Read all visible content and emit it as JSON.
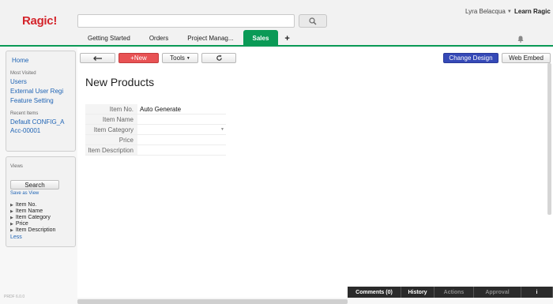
{
  "header": {
    "logo": "Ragic!",
    "search_placeholder": "",
    "user_name": "Lyra Belacqua",
    "learn_label": "Learn Ragic"
  },
  "tabs": [
    {
      "label": "Getting Started",
      "active": false
    },
    {
      "label": "Orders",
      "active": false
    },
    {
      "label": "Project Manag...",
      "active": false
    },
    {
      "label": "Sales",
      "active": true
    }
  ],
  "tab_add_label": "+",
  "sidebar": {
    "home": "Home",
    "most_visited_title": "Most Visited",
    "most_visited": [
      "Users",
      "External User Regi",
      "Feature Setting"
    ],
    "recent_title": "Recent Items",
    "recent": [
      "Default CONFIG_A",
      "Acc-00001"
    ],
    "views_title": "Views",
    "search_label": "Search",
    "save_as_view": "Save as View",
    "fields": [
      "Item No.",
      "Item Name",
      "Item Category",
      "Price",
      "Item Description"
    ],
    "less_label": "Less",
    "version": "PRDF 6.0.0"
  },
  "toolbar": {
    "new_label": "+New",
    "tools_label": "Tools",
    "change_design_label": "Change Design",
    "web_embed_label": "Web Embed"
  },
  "page": {
    "title": "New Products"
  },
  "form": {
    "rows": [
      {
        "label": "Item No.",
        "value": "Auto Generate"
      },
      {
        "label": "Item Name",
        "value": ""
      },
      {
        "label": "Item Category",
        "value": ""
      },
      {
        "label": "Price",
        "value": ""
      },
      {
        "label": "Item Description",
        "value": ""
      }
    ]
  },
  "bottom_bar": {
    "comments": "Comments (0)",
    "history": "History",
    "actions": "Actions",
    "approval": "Approval",
    "info": "i"
  },
  "colors": {
    "brand_red": "#d4242b",
    "tab_active": "#0a9a56",
    "new_button": "#e85254",
    "design_button": "#3549b7",
    "link": "#1f64b5"
  },
  "icons": {
    "search": "search-icon",
    "back": "back-arrow-icon",
    "refresh": "refresh-icon",
    "bell": "bell-icon",
    "caret": "caret-down-icon"
  }
}
